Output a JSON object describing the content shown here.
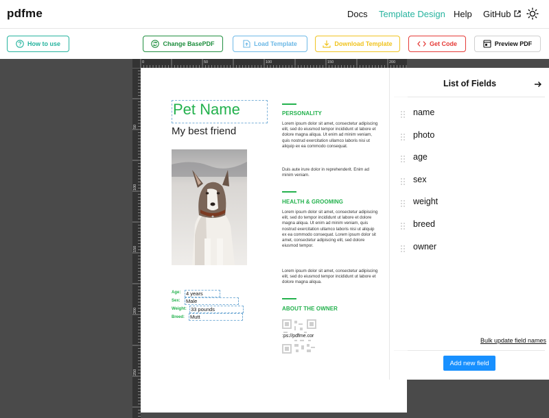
{
  "nav": {
    "brand": "pdfme",
    "links": [
      "Docs",
      "Template Design",
      "Help",
      "GitHub"
    ],
    "active_link": "Template Design",
    "external_icon": "external-link-icon",
    "theme_icon": "sun-icon"
  },
  "toolbar": {
    "how_to_use": "How to use",
    "change_basepdf": "Change BasePDF",
    "load_template": "Load Template",
    "download_template": "Download Template",
    "get_code": "Get Code",
    "preview_pdf": "Preview PDF"
  },
  "colors": {
    "teal": "#25b39e",
    "green": "#22b14c",
    "light_blue": "#6cb8e6",
    "yellow": "#f0c31f",
    "red": "#e53935",
    "primary": "#1890ff"
  },
  "ruler": {
    "top_labels": [
      "0",
      "50",
      "100",
      "150",
      "200"
    ],
    "left_labels": [
      "50",
      "100",
      "150",
      "200",
      "250"
    ]
  },
  "template": {
    "pet_name": "Pet Name",
    "subtitle": "My best friend",
    "info": [
      {
        "label": "Age:",
        "value": "4 years"
      },
      {
        "label": "Sex:",
        "value": "Male"
      },
      {
        "label": "Weight:",
        "value": "33 pounds"
      },
      {
        "label": "Breed:",
        "value": "Mutt"
      }
    ],
    "sections": [
      {
        "title": "PERSONALITY",
        "paragraphs": [
          "Lorem ipsum dolor sit amet, consectetur adipiscing elit, sed do eiusmod tempor incididunt ut labore et dolore magna aliqua. Ut enim ad minim veniam, quis nostrud exercitation ullamco laboris nisi ut aliquip ex ea commodo consequat.",
          "Duis aute irure dolor in reprehenderit. Enim ad minim veniam."
        ]
      },
      {
        "title": "HEALTH & GROOMING",
        "paragraphs": [
          "Lorem ipsum dolor sit amet, consectetur adipiscing elit, sed do tempor incididunt ut labore et dolore magna aliqua. Ut enim ad minim veniam, quis nostrud exercitation ullamco laboris nisi ut aliquip ex ea commodo consequat. Lorem ipsum dolor sit amet, consectetur adipiscing elit, sed dolore eiusmod tempor.",
          "Lorem ipsum dolor sit amet, consectetur adipiscing elit, sed do eiusmod tempor incididunt ut labore et dolore magna aliqua."
        ]
      },
      {
        "title": "ABOUT THE OWNER",
        "paragraphs": []
      }
    ],
    "qr_text": ":ps://pdfme.cor"
  },
  "panel": {
    "title": "List of Fields",
    "close_icon": "arrow-right-icon",
    "fields": [
      "name",
      "photo",
      "age",
      "sex",
      "weight",
      "breed",
      "owner"
    ],
    "bulk_update": "Bulk update field names",
    "add_field": "Add new field"
  }
}
